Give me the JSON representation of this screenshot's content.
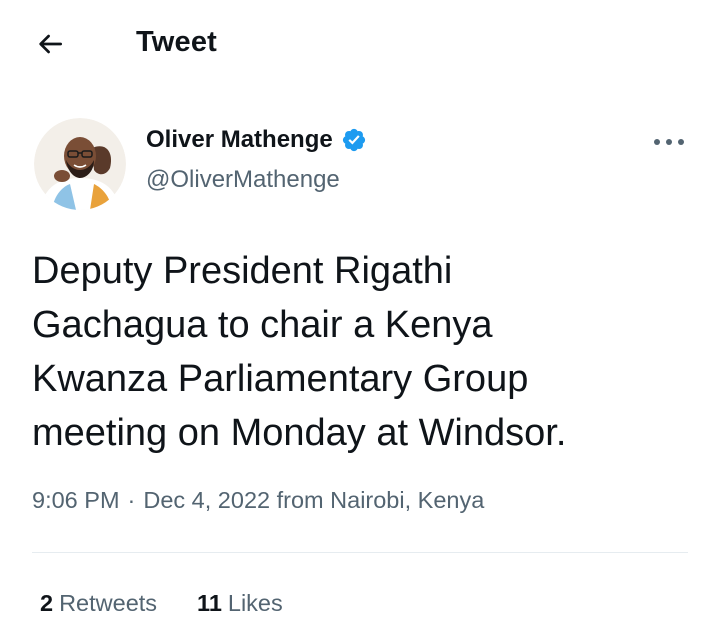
{
  "header": {
    "title": "Tweet",
    "back_icon": "arrow-left-icon"
  },
  "author": {
    "name": "Oliver Mathenge",
    "handle": "@OliverMathenge",
    "verified": true,
    "verified_icon": "verified-badge-icon",
    "verified_color": "#1d9bf0",
    "avatar_icon": "profile-photo"
  },
  "more_icon": "more-horizontal-icon",
  "tweet": {
    "text": "Deputy President Rigathi\nGachagua to chair a Kenya\nKwanza Parliamentary Group\nmeeting on Monday at Windsor.",
    "time": "9:06 PM",
    "separator": "·",
    "date": "Dec 4, 2022",
    "location": "from Nairobi, Kenya"
  },
  "stats": {
    "retweets_count": "2",
    "retweets_label": "Retweets",
    "likes_count": "11",
    "likes_label": "Likes"
  },
  "colors": {
    "text_primary": "#0f1419",
    "text_secondary": "#536471",
    "divider": "#e6ecf0",
    "background": "#ffffff"
  }
}
